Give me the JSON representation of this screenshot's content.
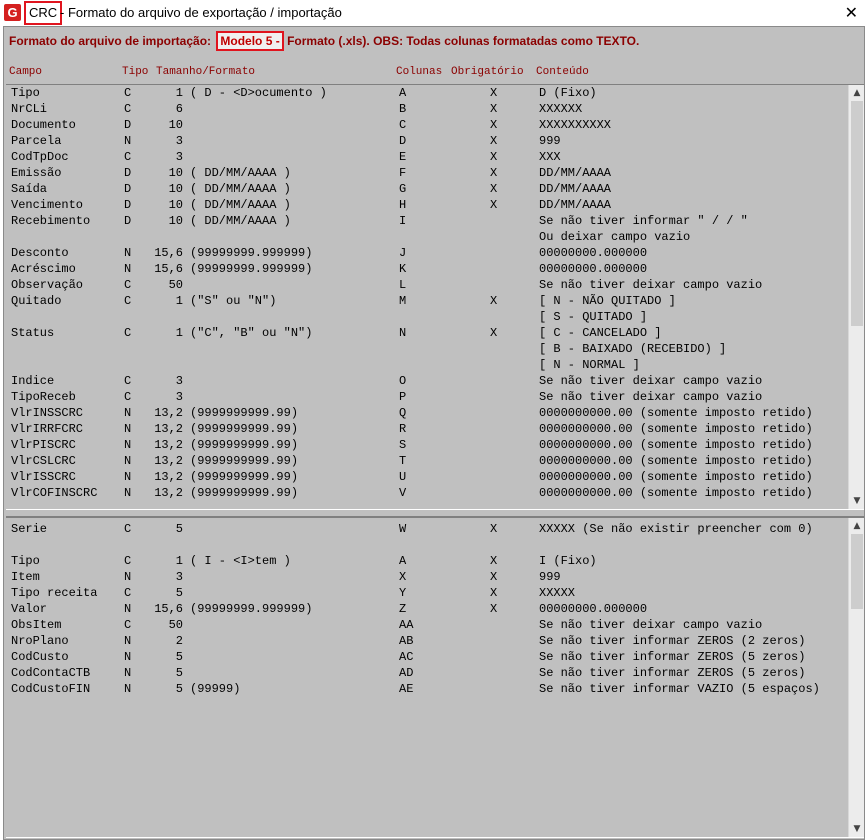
{
  "window": {
    "app_name": "CRC",
    "title_rest": "- Formato do arquivo de exportação / importação",
    "logo": "G",
    "close_glyph": "✕"
  },
  "header": {
    "prefix": "Formato do arquivo de importação:",
    "model": "Modelo 5 -",
    "suffix": "Formato (.xls). OBS: Todas colunas formatadas como TEXTO."
  },
  "columns": {
    "campo": "Campo",
    "tipo": "Tipo",
    "tamanho": "Tamanho/Formato",
    "colunas": "Colunas",
    "obrigatorio": "Obrigatório",
    "conteudo": "Conteúdo"
  },
  "top_rows": [
    {
      "campo": "Tipo",
      "tipo": "C",
      "tam": "1",
      "fmt": "( D - <D>ocumento )",
      "col": "A",
      "obr": "X",
      "cont": "D (Fixo)"
    },
    {
      "campo": "NrCLi",
      "tipo": "C",
      "tam": "6",
      "fmt": "",
      "col": "B",
      "obr": "X",
      "cont": "XXXXXX"
    },
    {
      "campo": "Documento",
      "tipo": "D",
      "tam": "10",
      "fmt": "",
      "col": "C",
      "obr": "X",
      "cont": "XXXXXXXXXX"
    },
    {
      "campo": "Parcela",
      "tipo": "N",
      "tam": "3",
      "fmt": "",
      "col": "D",
      "obr": "X",
      "cont": "999"
    },
    {
      "campo": "CodTpDoc",
      "tipo": "C",
      "tam": "3",
      "fmt": "",
      "col": "E",
      "obr": "X",
      "cont": "XXX"
    },
    {
      "campo": "Emissão",
      "tipo": "D",
      "tam": "10",
      "fmt": "( DD/MM/AAAA )",
      "col": "F",
      "obr": "X",
      "cont": "DD/MM/AAAA"
    },
    {
      "campo": "Saída",
      "tipo": "D",
      "tam": "10",
      "fmt": "( DD/MM/AAAA )",
      "col": "G",
      "obr": "X",
      "cont": "DD/MM/AAAA"
    },
    {
      "campo": "Vencimento",
      "tipo": "D",
      "tam": "10",
      "fmt": "( DD/MM/AAAA )",
      "col": "H",
      "obr": "X",
      "cont": "DD/MM/AAAA"
    },
    {
      "campo": "Recebimento",
      "tipo": "D",
      "tam": "10",
      "fmt": "( DD/MM/AAAA )",
      "col": "I",
      "obr": "",
      "cont": "Se não tiver informar \"  /  /    \""
    },
    {
      "campo": "",
      "tipo": "",
      "tam": "",
      "fmt": "",
      "col": "",
      "obr": "",
      "cont": "Ou deixar campo vazio"
    },
    {
      "campo": "Desconto",
      "tipo": "N",
      "tam": "15,6",
      "fmt": "(99999999.999999)",
      "col": "J",
      "obr": "",
      "cont": "00000000.000000"
    },
    {
      "campo": "Acréscimo",
      "tipo": "N",
      "tam": "15,6",
      "fmt": "(99999999.999999)",
      "col": "K",
      "obr": "",
      "cont": "00000000.000000"
    },
    {
      "campo": "Observação",
      "tipo": "C",
      "tam": "50",
      "fmt": "",
      "col": "L",
      "obr": "",
      "cont": "Se não tiver deixar campo vazio"
    },
    {
      "campo": "Quitado",
      "tipo": "C",
      "tam": "1",
      "fmt": "(\"S\" ou \"N\")",
      "col": "M",
      "obr": "X",
      "cont": "[ N - NÃO QUITADO ]"
    },
    {
      "campo": "",
      "tipo": "",
      "tam": "",
      "fmt": "",
      "col": "",
      "obr": "",
      "cont": "[ S - QUITADO ]"
    },
    {
      "campo": "Status",
      "tipo": "C",
      "tam": "1",
      "fmt": "(\"C\", \"B\" ou \"N\")",
      "col": "N",
      "obr": "X",
      "cont": "[ C - CANCELADO ]"
    },
    {
      "campo": "",
      "tipo": "",
      "tam": "",
      "fmt": "",
      "col": "",
      "obr": "",
      "cont": "[ B - BAIXADO (RECEBIDO) ]"
    },
    {
      "campo": "",
      "tipo": "",
      "tam": "",
      "fmt": "",
      "col": "",
      "obr": "",
      "cont": "[ N - NORMAL ]"
    },
    {
      "campo": "Indice",
      "tipo": "C",
      "tam": "3",
      "fmt": "",
      "col": "O",
      "obr": "",
      "cont": "Se não tiver deixar campo vazio"
    },
    {
      "campo": "TipoReceb",
      "tipo": "C",
      "tam": "3",
      "fmt": "",
      "col": "P",
      "obr": "",
      "cont": "Se não tiver deixar campo vazio"
    },
    {
      "campo": "VlrINSSCRC",
      "tipo": "N",
      "tam": "13,2",
      "fmt": "(9999999999.99)",
      "col": "Q",
      "obr": "",
      "cont": "0000000000.00 (somente imposto retido)"
    },
    {
      "campo": "VlrIRRFCRC",
      "tipo": "N",
      "tam": "13,2",
      "fmt": "(9999999999.99)",
      "col": "R",
      "obr": "",
      "cont": "0000000000.00 (somente imposto retido)"
    },
    {
      "campo": "VlrPISCRC",
      "tipo": "N",
      "tam": "13,2",
      "fmt": "(9999999999.99)",
      "col": "S",
      "obr": "",
      "cont": "0000000000.00 (somente imposto retido)"
    },
    {
      "campo": "VlrCSLCRC",
      "tipo": "N",
      "tam": "13,2",
      "fmt": "(9999999999.99)",
      "col": "T",
      "obr": "",
      "cont": "0000000000.00 (somente imposto retido)"
    },
    {
      "campo": "VlrISSCRC",
      "tipo": "N",
      "tam": "13,2",
      "fmt": "(9999999999.99)",
      "col": "U",
      "obr": "",
      "cont": "0000000000.00 (somente imposto retido)"
    },
    {
      "campo": "VlrCOFINSCRC",
      "tipo": "N",
      "tam": "13,2",
      "fmt": "(9999999999.99)",
      "col": "V",
      "obr": "",
      "cont": "0000000000.00 (somente imposto retido)"
    }
  ],
  "bottom_rows": [
    {
      "campo": "Serie",
      "tipo": "C",
      "tam": "5",
      "fmt": "",
      "col": "W",
      "obr": "X",
      "cont": "XXXXX (Se não existir preencher com 0)"
    },
    {
      "campo": "",
      "tipo": "",
      "tam": "",
      "fmt": "",
      "col": "",
      "obr": "",
      "cont": ""
    },
    {
      "campo": "Tipo",
      "tipo": "C",
      "tam": "1",
      "fmt": "( I - <I>tem )",
      "col": "A",
      "obr": "X",
      "cont": "I (Fixo)"
    },
    {
      "campo": "Item",
      "tipo": "N",
      "tam": "3",
      "fmt": "",
      "col": "X",
      "obr": "X",
      "cont": "999"
    },
    {
      "campo": "Tipo receita",
      "tipo": "C",
      "tam": "5",
      "fmt": "",
      "col": "Y",
      "obr": "X",
      "cont": "XXXXX"
    },
    {
      "campo": "Valor",
      "tipo": "N",
      "tam": "15,6",
      "fmt": "(99999999.999999)",
      "col": "Z",
      "obr": "X",
      "cont": "00000000.000000"
    },
    {
      "campo": "ObsItem",
      "tipo": "C",
      "tam": "50",
      "fmt": "",
      "col": "AA",
      "obr": "",
      "cont": "Se não tiver deixar campo vazio"
    },
    {
      "campo": "NroPlano",
      "tipo": "N",
      "tam": "2",
      "fmt": "",
      "col": "AB",
      "obr": "",
      "cont": "Se não tiver informar ZEROS (2 zeros)"
    },
    {
      "campo": "CodCusto",
      "tipo": "N",
      "tam": "5",
      "fmt": "",
      "col": "AC",
      "obr": "",
      "cont": "Se não tiver informar ZEROS (5 zeros)"
    },
    {
      "campo": "CodContaCTB",
      "tipo": "N",
      "tam": "5",
      "fmt": "",
      "col": "AD",
      "obr": "",
      "cont": "Se não tiver informar ZEROS (5 zeros)"
    },
    {
      "campo": "CodCustoFIN",
      "tipo": "N",
      "tam": "5",
      "fmt": "(99999)",
      "col": "AE",
      "obr": "",
      "cont": "Se não tiver informar VAZIO (5 espaços)"
    }
  ],
  "scroll": {
    "up_glyph": "▲",
    "down_glyph": "▼",
    "top_position": 0.0,
    "bottom_position": 0.0
  },
  "colors": {
    "header_text": "#8b0000",
    "highlight_border": "#e0141e",
    "panel_bg": "#c0c0c0",
    "logo_bg": "#d4201f"
  }
}
